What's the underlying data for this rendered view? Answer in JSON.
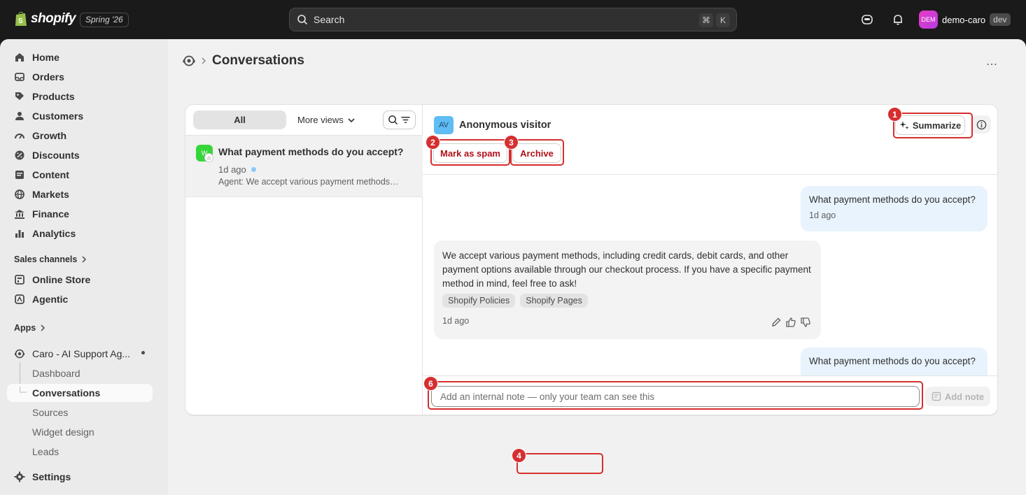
{
  "topbar": {
    "brand": "shopify",
    "edition": "Spring '26",
    "search_placeholder": "Search",
    "shortcut_cmd": "⌘",
    "shortcut_key": "K",
    "user_initials": "DEM",
    "user_name": "demo-caro",
    "user_badge": "dev"
  },
  "sidebar": {
    "items": [
      {
        "label": "Home",
        "icon": "home-icon"
      },
      {
        "label": "Orders",
        "icon": "inbox-icon"
      },
      {
        "label": "Products",
        "icon": "tag-icon"
      },
      {
        "label": "Customers",
        "icon": "person-icon"
      },
      {
        "label": "Growth",
        "icon": "gauge-icon"
      },
      {
        "label": "Discounts",
        "icon": "discount-icon"
      },
      {
        "label": "Content",
        "icon": "content-icon"
      },
      {
        "label": "Markets",
        "icon": "globe-icon"
      },
      {
        "label": "Finance",
        "icon": "bank-icon"
      },
      {
        "label": "Analytics",
        "icon": "bar-chart-icon"
      }
    ],
    "sales_channels_label": "Sales channels",
    "channels": [
      {
        "label": "Online Store",
        "icon": "store-icon"
      },
      {
        "label": "Agentic",
        "icon": "agentic-icon"
      }
    ],
    "apps_label": "Apps",
    "app_name": "Caro - AI Support Ag...",
    "app_subitems": [
      "Dashboard",
      "Conversations",
      "Sources",
      "Widget design",
      "Leads"
    ],
    "settings_label": "Settings"
  },
  "page": {
    "title": "Conversations",
    "more_actions": "⋯"
  },
  "list": {
    "tab_all": "All",
    "tab_more": "More views",
    "conversation": {
      "avatar": "W",
      "title": "What payment methods do you accept?",
      "time": "1d ago",
      "preview": "Agent: We accept various payment methods, including credit cards, debit cards"
    }
  },
  "detail": {
    "visitor_initials": "AV",
    "visitor_name": "Anonymous visitor",
    "summarize_label": "Summarize",
    "spam_label": "Mark as spam",
    "archive_label": "Archive",
    "messages": {
      "user_1": {
        "text": "What payment methods do you accept?",
        "time": "1d ago"
      },
      "agent_1": {
        "text": "We accept various payment methods, including credit cards, debit cards, and other payment options available through our checkout process. If you have a specific payment method in mind, feel free to ask!",
        "sources": [
          "Shopify Policies",
          "Shopify Pages"
        ],
        "time": "1d ago"
      },
      "user_2": {
        "text": "What payment methods do you accept?"
      }
    },
    "note_placeholder": "Add an internal note — only your team can see this",
    "add_note_label": "Add note"
  },
  "annotations": [
    "1",
    "2",
    "3",
    "4",
    "6"
  ],
  "colors": {
    "annotation": "#d62f2f",
    "danger_text": "#b0111a",
    "user_bubble": "#e8f3fd",
    "agent_bubble": "#f3f3f3"
  }
}
